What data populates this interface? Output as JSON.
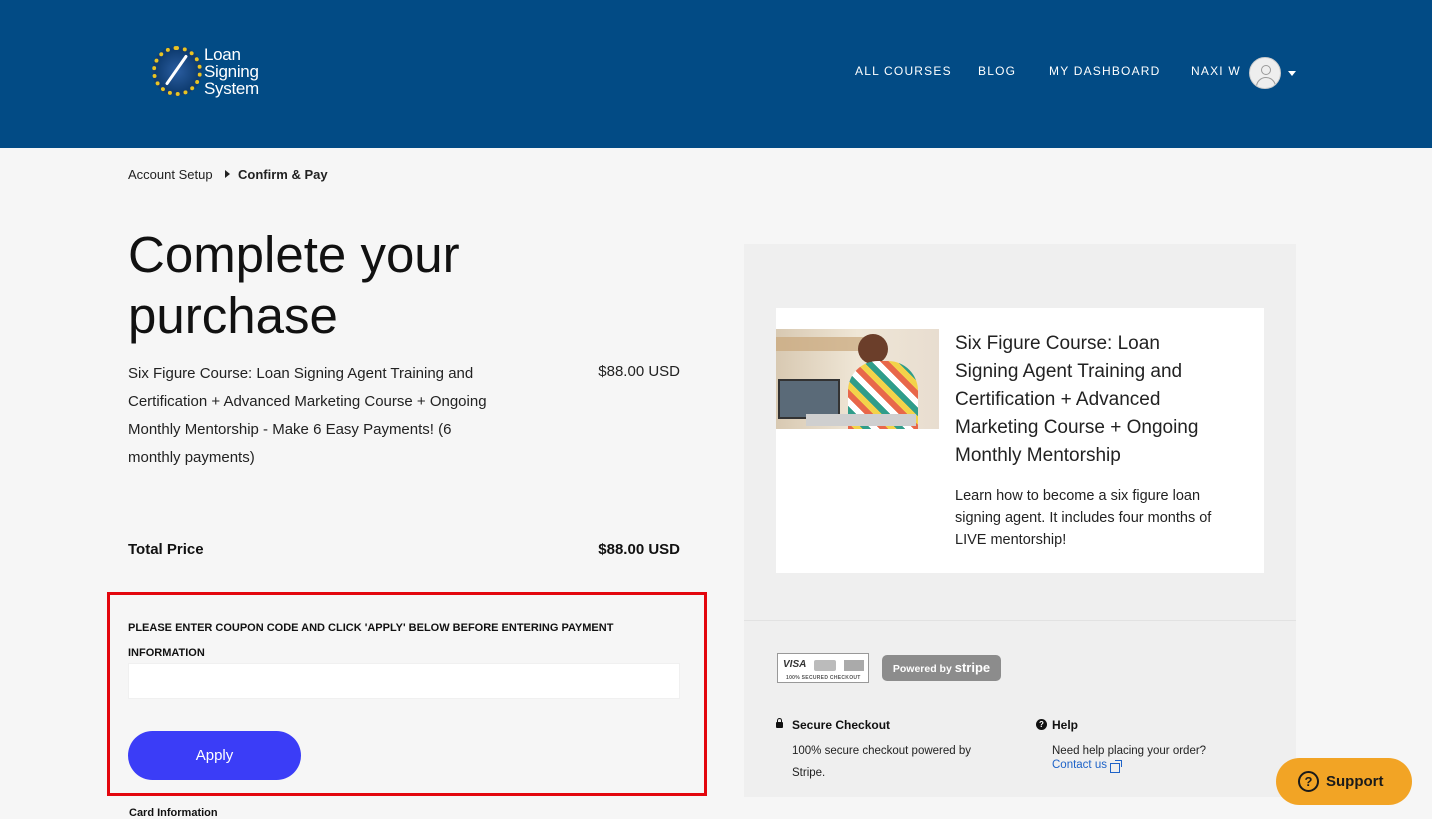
{
  "header": {
    "logo_lines": [
      "Loan",
      "Signing",
      "System"
    ],
    "nav": [
      "ALL COURSES",
      "BLOG",
      "MY DASHBOARD"
    ],
    "user_name": "NAXI W"
  },
  "breadcrumb": {
    "step1": "Account Setup",
    "step2": "Confirm & Pay"
  },
  "checkout": {
    "title": "Complete your purchase",
    "item_name": "Six Figure Course: Loan Signing Agent Training and Certification + Advanced Marketing Course + Ongoing Monthly Mentorship - Make 6 Easy Payments! (6 monthly payments)",
    "item_price": "$88.00 USD",
    "total_label": "Total Price",
    "total_value": "$88.00 USD",
    "coupon_label": "PLEASE ENTER COUPON CODE AND CLICK 'APPLY' BELOW BEFORE ENTERING PAYMENT INFORMATION",
    "coupon_value": "",
    "apply_label": "Apply",
    "card_info_label": "Card Information",
    "highlight_color": "#e3060e",
    "button_color": "#3b3df7"
  },
  "summary": {
    "course_title": "Six Figure Course: Loan Signing Agent Training and Certification + Advanced Marketing Course + Ongoing Monthly Mentorship",
    "course_desc": "Learn how to become a six figure loan signing agent. It includes four months of LIVE mentorship!",
    "badge_cards": "VISA",
    "badge_sub": "100% SECURED CHECKOUT",
    "stripe_prefix": "Powered by",
    "stripe_brand": "stripe",
    "secure_head": "Secure Checkout",
    "secure_text": "100% secure checkout powered by Stripe.",
    "help_head": "Help",
    "help_text": "Need help placing your order?",
    "contact_link": "Contact us"
  },
  "support": {
    "label": "Support",
    "color": "#f2a425"
  },
  "icons": [
    "logo-icon",
    "user-avatar-icon",
    "chevron-down-icon",
    "chevron-right-icon",
    "lock-icon",
    "help-icon",
    "external-link-icon",
    "question-icon"
  ],
  "colors": {
    "header_bg": "#024b85",
    "page_bg": "#f6f6f6"
  }
}
